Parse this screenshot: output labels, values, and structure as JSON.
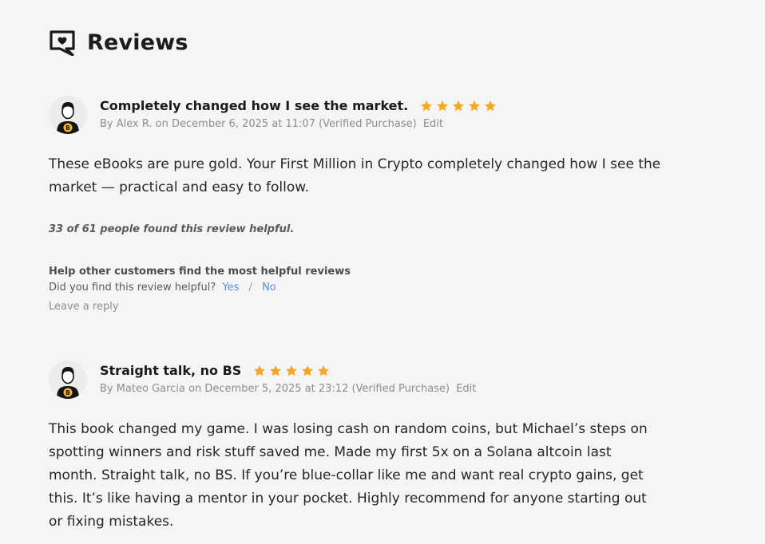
{
  "section": {
    "title": "Reviews",
    "icon": "chat-heart-icon"
  },
  "colors": {
    "star": "#f5a623",
    "link": "#5b8fd8",
    "bitcoin": "#f7b72b"
  },
  "reviews": [
    {
      "title": "Completely changed how I see the market.",
      "rating": 5,
      "byline": "By Alex R. on December 6, 2025 at 11:07 (Verified Purchase)",
      "edit": "Edit",
      "body": "These eBooks are pure gold. Your First Million in Crypto completely changed how I see the market — practical and easy to follow.",
      "helpful_count": "33 of 61 people found this review helpful.",
      "help_prompt": "Help other customers find the most helpful reviews",
      "vote_question": "Did you find this review helpful?",
      "yes": "Yes",
      "separator": "/",
      "no": "No",
      "reply": "Leave a reply"
    },
    {
      "title": "Straight talk, no BS",
      "rating": 5,
      "byline": "By Mateo Garcia on December 5, 2025 at 23:12 (Verified Purchase)",
      "edit": "Edit",
      "body": "This book changed my game. I was losing cash on random coins, but Michael’s steps on spotting winners and risk stuff saved me. Made my first 5x on a Solana altcoin last month. Straight talk, no BS. If you’re blue-collar like me and want real crypto gains, get this. It’s like having a mentor in your pocket. Highly recommend for anyone starting out or fixing mistakes."
    }
  ]
}
